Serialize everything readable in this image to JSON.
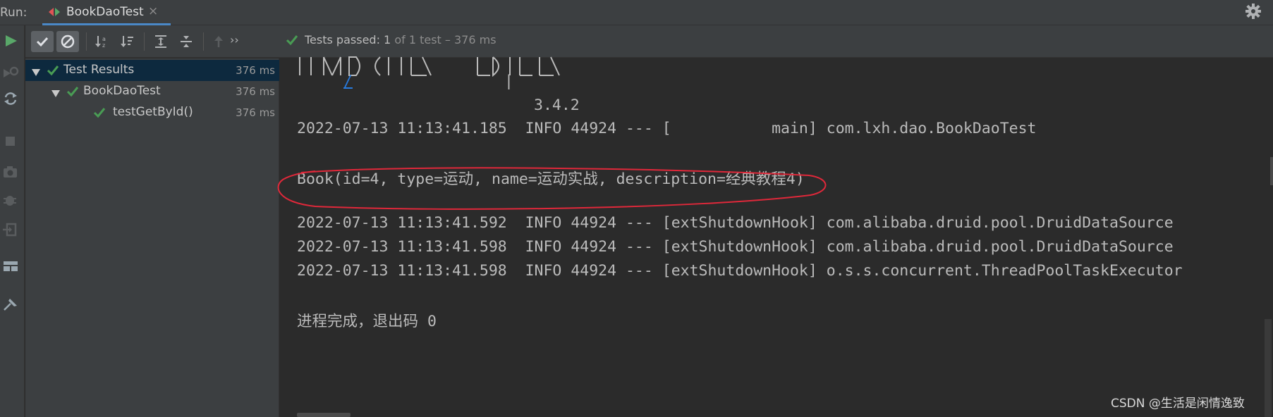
{
  "tabbar": {
    "run_label": "Run:",
    "tab_title": "BookDaoTest",
    "tab_close": "×"
  },
  "toolbar": {
    "status_prefix": "Tests passed: ",
    "passed_count": "1",
    "status_suffix": " of 1 test – 376 ms",
    "more_glyph": "››"
  },
  "tree": {
    "rows": [
      {
        "name": "Test Results",
        "time": "376 ms"
      },
      {
        "name": "BookDaoTest",
        "time": "376 ms"
      },
      {
        "name": "testGetById()",
        "time": "376 ms"
      }
    ]
  },
  "console": {
    "banner_slash": "/",
    "banner_pipe": "|",
    "version": "3.4.2",
    "lines": [
      "2022-07-13 11:13:41.185  INFO 44924 --- [           main] com.lxh.dao.BookDaoTest",
      "Book(id=4, type=运动, name=运动实战, description=经典教程4)",
      "2022-07-13 11:13:41.592  INFO 44924 --- [extShutdownHook] com.alibaba.druid.pool.DruidDataSource",
      "2022-07-13 11:13:41.598  INFO 44924 --- [extShutdownHook] com.alibaba.druid.pool.DruidDataSource",
      "2022-07-13 11:13:41.598  INFO 44924 --- [extShutdownHook] o.s.s.concurrent.ThreadPoolTaskExecutor",
      "进程完成，退出码 0"
    ]
  },
  "watermark": "CSDN @生活是闲情逸致",
  "colors": {
    "pass_green": "#499c54",
    "run_green": "#59a869",
    "annotation_red": "#e0283a",
    "selection": "#0d293e",
    "link_blue": "#287bde"
  },
  "icons": {
    "tab": "junit-run-config-icon",
    "settings": "gear-icon",
    "status": "check-icon"
  }
}
